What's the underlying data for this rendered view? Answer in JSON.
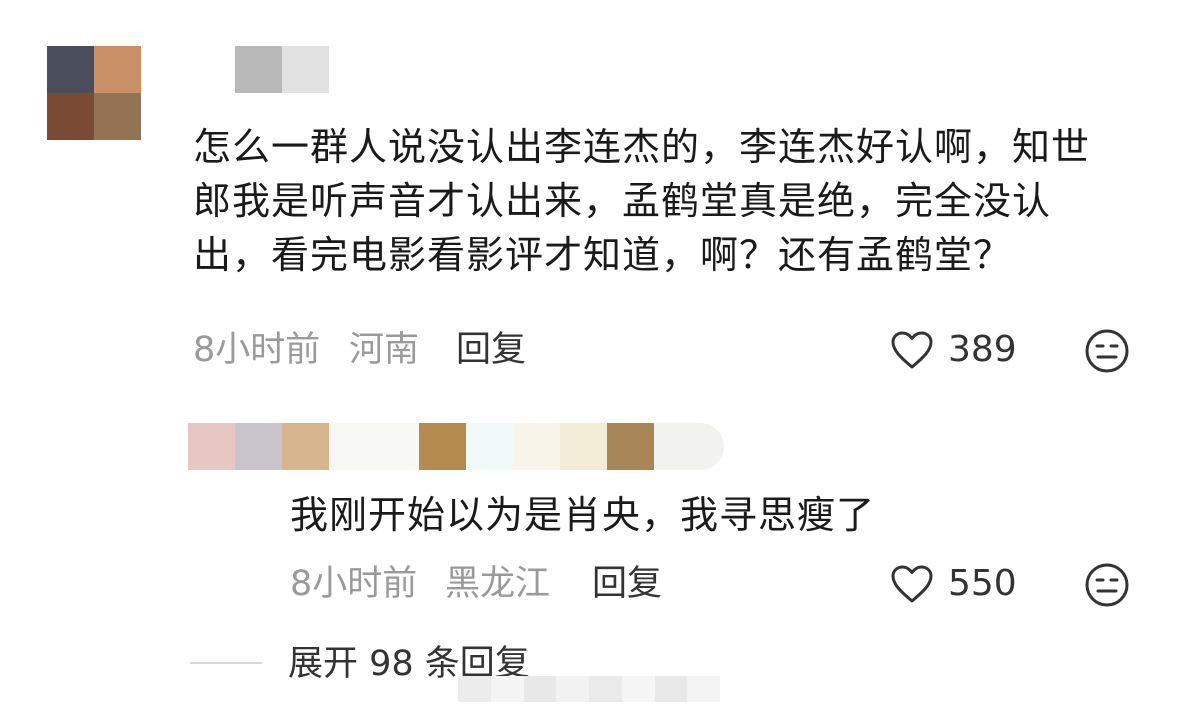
{
  "comment": {
    "text": "怎么一群人说没认出李连杰的，李连杰好认啊，知世郎我是听声音才认出来，孟鹤堂真是绝，完全没认出，看完电影看影评才知道，啊？还有孟鹤堂？",
    "time": "8小时前",
    "location": "河南",
    "reply_label": "回复",
    "likes": "389",
    "like_icon": "heart-outline-icon",
    "dislike_icon": "meh-face-icon"
  },
  "reply": {
    "text": "我刚开始以为是肖央，我寻思瘦了",
    "time": "8小时前",
    "location": "黑龙江",
    "reply_label": "回复",
    "likes": "550"
  },
  "expand": {
    "label": "展开 98 条回复"
  },
  "colors": {
    "text": "#1a1a1a",
    "meta": "#9a9a9a",
    "icon": "#333333"
  }
}
